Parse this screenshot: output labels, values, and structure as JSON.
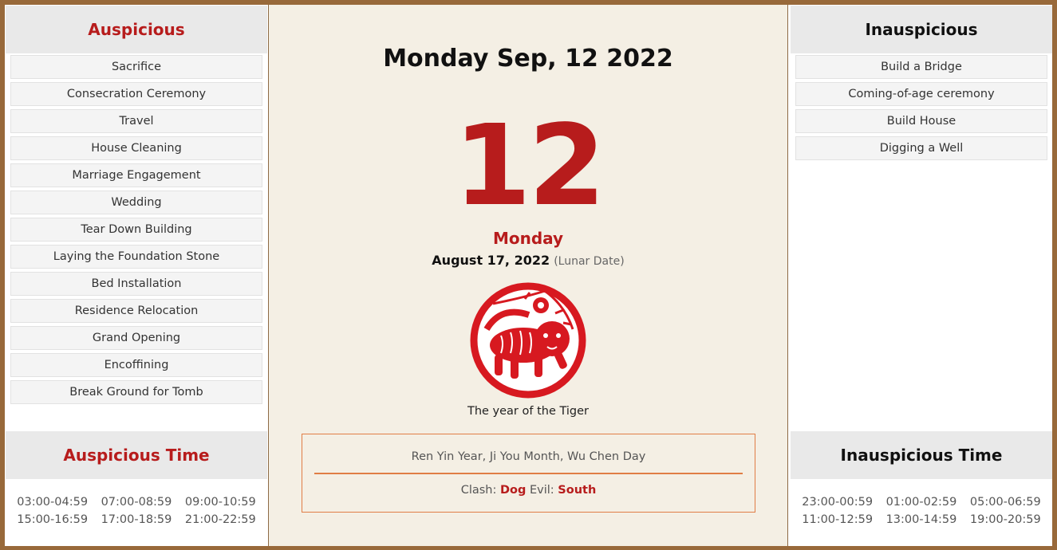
{
  "auspicious": {
    "title": "Auspicious",
    "items": [
      "Sacrifice",
      "Consecration Ceremony",
      "Travel",
      "House Cleaning",
      "Marriage Engagement",
      "Wedding",
      "Tear Down Building",
      "Laying the Foundation Stone",
      "Bed Installation",
      "Residence Relocation",
      "Grand Opening",
      "Encoffining",
      "Break Ground for Tomb"
    ]
  },
  "auspicious_time": {
    "title": "Auspicious Time",
    "times": [
      "03:00-04:59",
      "07:00-08:59",
      "09:00-10:59",
      "15:00-16:59",
      "17:00-18:59",
      "21:00-22:59"
    ]
  },
  "inauspicious": {
    "title": "Inauspicious",
    "items": [
      "Build a Bridge",
      "Coming-of-age ceremony",
      "Build House",
      "Digging a Well"
    ]
  },
  "inauspicious_time": {
    "title": "Inauspicious Time",
    "times": [
      "23:00-00:59",
      "01:00-02:59",
      "05:00-06:59",
      "11:00-12:59",
      "13:00-14:59",
      "19:00-20:59"
    ]
  },
  "center": {
    "title": "Monday Sep, 12 2022",
    "day_number": "12",
    "weekday": "Monday",
    "lunar_date": "August 17, 2022",
    "lunar_note": "(Lunar Date)",
    "zodiac_icon": "tiger-papercut-icon",
    "zodiac_label": "The year of the Tiger",
    "ganzhi": "Ren Yin Year, Ji You Month, Wu Chen Day",
    "clash_label": "Clash:",
    "clash_value": "Dog",
    "evil_label": "Evil:",
    "evil_value": "South"
  },
  "colors": {
    "accent_red": "#b71c1c",
    "frame_brown": "#98693a",
    "box_orange": "#e07d45"
  }
}
